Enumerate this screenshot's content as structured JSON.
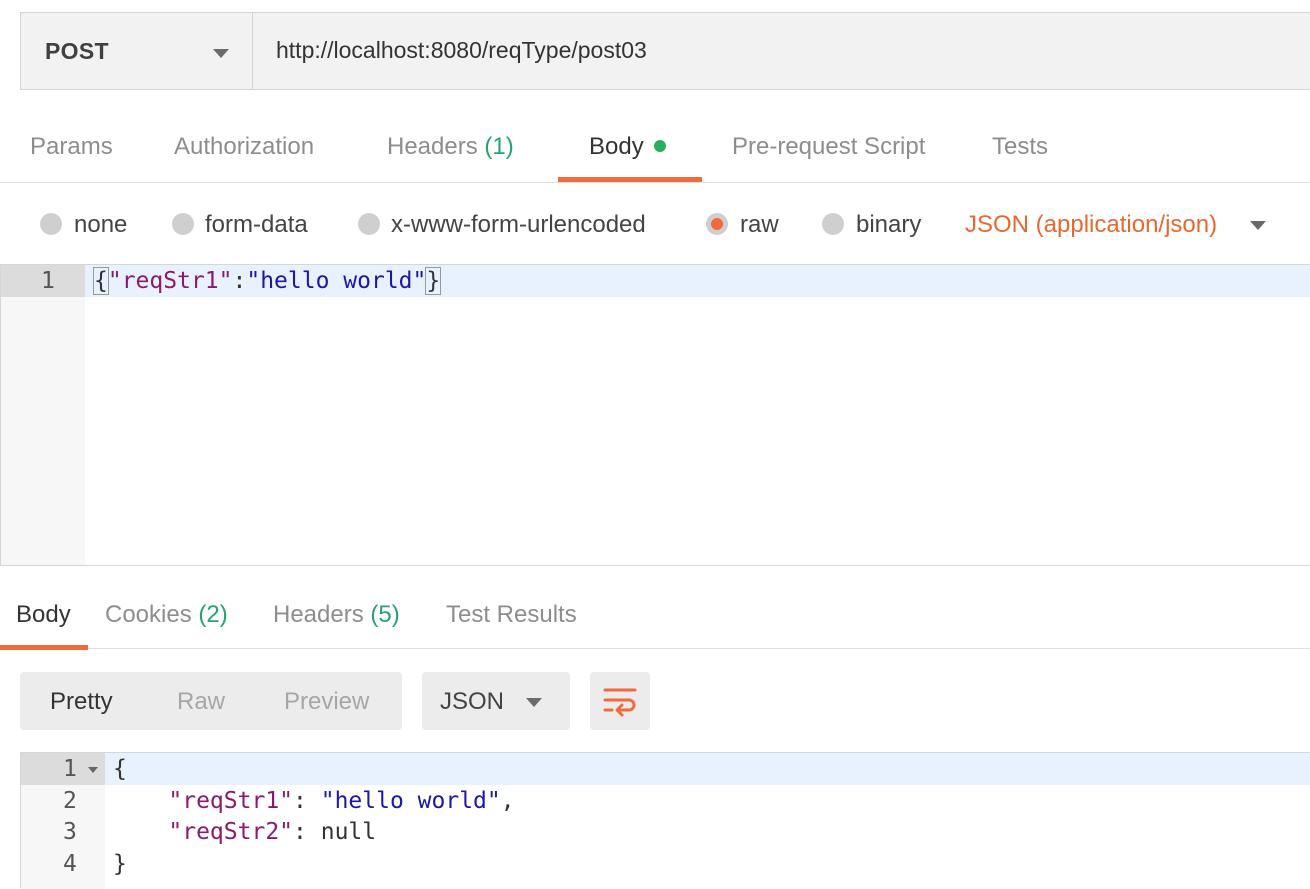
{
  "request": {
    "method": "POST",
    "url": "http://localhost:8080/reqType/post03"
  },
  "request_tabs": {
    "params": "Params",
    "authorization": "Authorization",
    "headers": "Headers",
    "headers_count": "(1)",
    "body": "Body",
    "pre_request": "Pre-request Script",
    "tests": "Tests",
    "active": "Body"
  },
  "body_types": {
    "none": "none",
    "form_data": "form-data",
    "urlencoded": "x-www-form-urlencoded",
    "raw": "raw",
    "binary": "binary",
    "selected": "raw",
    "content_type": "JSON (application/json)"
  },
  "request_editor": {
    "lines": [
      {
        "no": "1",
        "tokens": [
          "{",
          "\"reqStr1\"",
          ":",
          "\"hello world\"",
          "}"
        ]
      }
    ]
  },
  "response_tabs": {
    "body": "Body",
    "cookies": "Cookies",
    "cookies_count": "(2)",
    "headers": "Headers",
    "headers_count": "(5)",
    "test_results": "Test Results",
    "active": "Body"
  },
  "response_toolbar": {
    "pretty": "Pretty",
    "raw": "Raw",
    "preview": "Preview",
    "active_view": "Pretty",
    "format": "JSON",
    "wrap_icon": "wrap-lines-icon"
  },
  "response_editor": {
    "lines": [
      {
        "no": "1",
        "text": "{"
      },
      {
        "no": "2",
        "key": "\"reqStr1\"",
        "sep": ": ",
        "value": "\"hello world\"",
        "trail": ","
      },
      {
        "no": "3",
        "key": "\"reqStr2\"",
        "sep": ": ",
        "value": "null",
        "trail": ""
      },
      {
        "no": "4",
        "text": "}"
      }
    ]
  },
  "colors": {
    "accent": "#f06a3d",
    "count_green": "#25a46f",
    "json_key": "#8b1a6b",
    "json_string": "#1b17a8"
  }
}
